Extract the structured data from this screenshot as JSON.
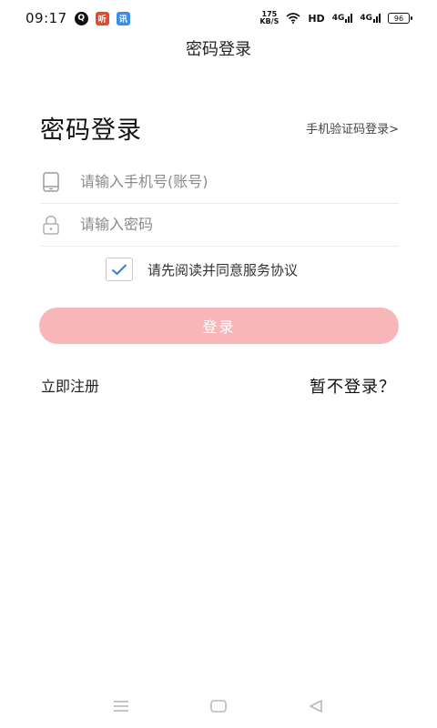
{
  "status_bar": {
    "time": "09:17",
    "app_badge_1": "Q",
    "app_badge_2": "听",
    "app_badge_3": "讯",
    "net_speed_value": "175",
    "net_speed_unit": "KB/S",
    "hd_label": "HD",
    "signal_1_label": "4G",
    "signal_2_label": "4G",
    "battery_level": "96"
  },
  "header": {
    "title": "密码登录"
  },
  "main": {
    "heading": "密码登录",
    "sms_login_link": "手机验证码登录>",
    "phone_field": {
      "placeholder": "请输入手机号(账号)",
      "value": ""
    },
    "password_field": {
      "placeholder": "请输入密码",
      "value": ""
    },
    "agreement_text": "请先阅读并同意服务协议",
    "agreement_checked": true,
    "login_button": "登录",
    "register_link": "立即注册",
    "skip_link": "暂不登录？"
  },
  "colors": {
    "login_button_bg": "#f9b6b8",
    "checkmark": "#2f7fd8"
  },
  "nav_bar": {
    "icons": [
      "menu-icon",
      "home-icon",
      "back-icon"
    ]
  }
}
